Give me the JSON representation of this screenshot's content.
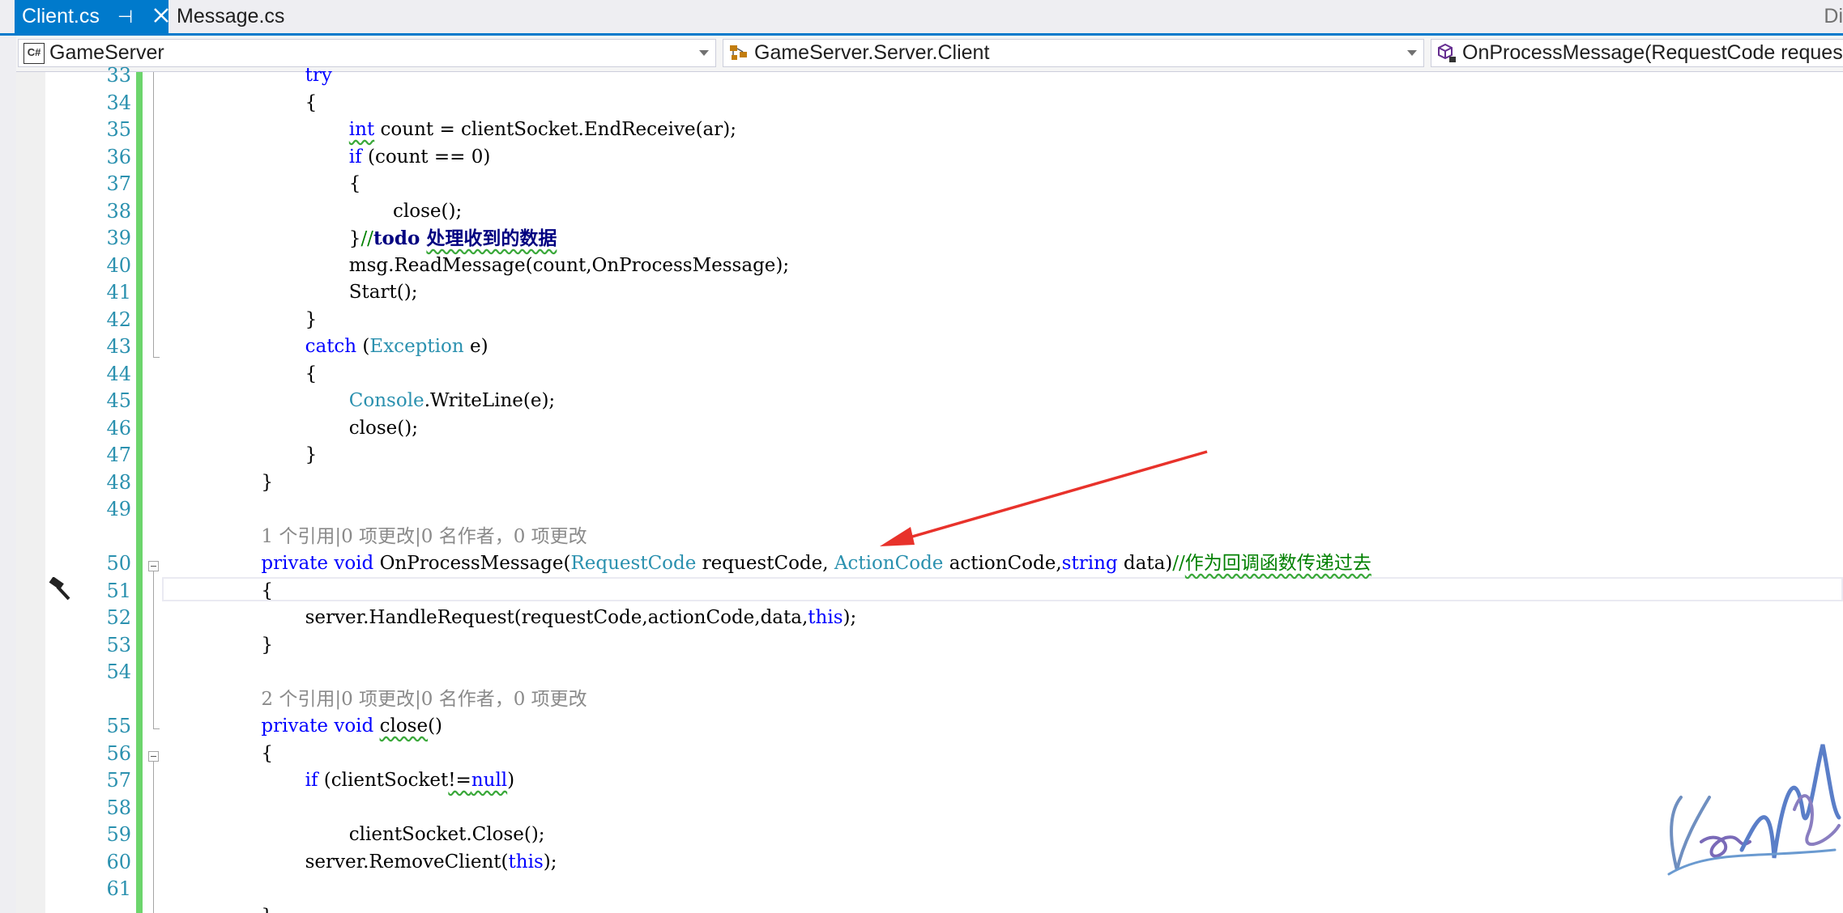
{
  "tabs": [
    {
      "label": "Client.cs",
      "active": true
    },
    {
      "label": "Message.cs",
      "active": false
    }
  ],
  "tab_corner_text": "Di",
  "nav": {
    "project": "GameServer",
    "type": "GameServer.Server.Client",
    "member": "OnProcessMessage(RequestCode reques"
  },
  "icons": {
    "project": "csharp-project-icon",
    "type": "class-icon",
    "member": "method-icon",
    "margin": "hammer-icon",
    "pin": "pin-icon",
    "close": "close-icon"
  },
  "colors": {
    "accent": "#007acc",
    "line_number": "#2b91af",
    "keyword": "#0000ff",
    "type": "#2b91af",
    "comment": "#008000",
    "changed_bar": "#6cd56c",
    "arrow": "#e8322b"
  },
  "code_lines": [
    {
      "n": "33",
      "indent": 3,
      "t": [
        [
          "kw",
          "try"
        ]
      ]
    },
    {
      "n": "34",
      "indent": 3,
      "t": [
        [
          "",
          "{"
        ]
      ]
    },
    {
      "n": "35",
      "indent": 4,
      "t": [
        [
          "kw sq",
          "int"
        ],
        [
          "",
          " count = clientSocket.EndReceive(ar);"
        ]
      ]
    },
    {
      "n": "36",
      "indent": 4,
      "t": [
        [
          "kw",
          "if"
        ],
        [
          "",
          " (count == 0)"
        ]
      ]
    },
    {
      "n": "37",
      "indent": 4,
      "t": [
        [
          "",
          "{"
        ]
      ]
    },
    {
      "n": "38",
      "indent": 5,
      "t": [
        [
          "",
          "close();"
        ]
      ]
    },
    {
      "n": "39",
      "indent": 4,
      "t": [
        [
          "",
          "}"
        ],
        [
          "cm",
          "//"
        ],
        [
          "todo",
          "todo "
        ],
        [
          "todo sq",
          "处理收到的数据"
        ]
      ]
    },
    {
      "n": "40",
      "indent": 4,
      "t": [
        [
          "",
          "msg.ReadMessage(count,OnProcessMessage);"
        ]
      ]
    },
    {
      "n": "41",
      "indent": 4,
      "t": [
        [
          "",
          "Start();"
        ]
      ]
    },
    {
      "n": "42",
      "indent": 3,
      "t": [
        [
          "",
          "}"
        ]
      ]
    },
    {
      "n": "43",
      "indent": 3,
      "t": [
        [
          "kw",
          "catch"
        ],
        [
          "",
          " ("
        ],
        [
          "ty",
          "Exception"
        ],
        [
          "",
          " e)"
        ]
      ]
    },
    {
      "n": "44",
      "indent": 3,
      "t": [
        [
          "",
          "{"
        ]
      ]
    },
    {
      "n": "45",
      "indent": 4,
      "t": [
        [
          "ty",
          "Console"
        ],
        [
          "",
          ".WriteLine(e);"
        ]
      ]
    },
    {
      "n": "46",
      "indent": 4,
      "t": [
        [
          "",
          "close();"
        ]
      ]
    },
    {
      "n": "47",
      "indent": 3,
      "t": [
        [
          "",
          "}"
        ]
      ]
    },
    {
      "n": "48",
      "indent": 2,
      "t": [
        [
          "",
          "}"
        ]
      ]
    },
    {
      "n": "49",
      "indent": 2,
      "t": []
    },
    {
      "n": "",
      "indent": 2,
      "lens": "1 个引用|0 项更改|0 名作者，0 项更改"
    },
    {
      "n": "50",
      "indent": 2,
      "t": [
        [
          "kw",
          "private"
        ],
        [
          "",
          " "
        ],
        [
          "kw",
          "void"
        ],
        [
          "",
          " OnProcessMessage("
        ],
        [
          "ty",
          "RequestCode"
        ],
        [
          "",
          " requestCode, "
        ],
        [
          "ty",
          "ActionCode"
        ],
        [
          "",
          " actionCode,"
        ],
        [
          "kw",
          "string"
        ],
        [
          "",
          " data)"
        ],
        [
          "cm",
          "//"
        ],
        [
          "cm sq",
          "作为回调函数传递过去"
        ]
      ]
    },
    {
      "n": "51",
      "indent": 2,
      "t": [
        [
          "",
          "{"
        ]
      ]
    },
    {
      "n": "52",
      "indent": 3,
      "t": [
        [
          "",
          "server.HandleRequest(requestCode,actionCode,data,"
        ],
        [
          "kw",
          "this"
        ],
        [
          "",
          ");"
        ]
      ]
    },
    {
      "n": "53",
      "indent": 2,
      "t": [
        [
          "",
          "}"
        ]
      ]
    },
    {
      "n": "54",
      "indent": 2,
      "t": []
    },
    {
      "n": "",
      "indent": 2,
      "lens": "2 个引用|0 项更改|0 名作者，0 项更改"
    },
    {
      "n": "55",
      "indent": 2,
      "t": [
        [
          "kw",
          "private"
        ],
        [
          "",
          " "
        ],
        [
          "kw",
          "void"
        ],
        [
          "",
          " "
        ],
        [
          "sq",
          "close"
        ],
        [
          "",
          "()"
        ]
      ]
    },
    {
      "n": "56",
      "indent": 2,
      "t": [
        [
          "",
          "{"
        ]
      ]
    },
    {
      "n": "57",
      "indent": 3,
      "t": [
        [
          "kw",
          "if"
        ],
        [
          "",
          " (clientSocket"
        ],
        [
          "sq",
          "!="
        ],
        [
          "kw sq",
          "null"
        ],
        [
          "",
          ")"
        ]
      ]
    },
    {
      "n": "58",
      "indent": 3,
      "t": []
    },
    {
      "n": "59",
      "indent": 4,
      "t": [
        [
          "",
          "clientSocket.Close();"
        ]
      ]
    },
    {
      "n": "60",
      "indent": 3,
      "t": [
        [
          "",
          "server.RemoveClient("
        ],
        [
          "kw",
          "this"
        ],
        [
          "",
          ");"
        ]
      ]
    },
    {
      "n": "61",
      "indent": 3,
      "t": []
    },
    {
      "n": "",
      "indent": 2,
      "t": [
        [
          "",
          "}"
        ]
      ]
    }
  ]
}
